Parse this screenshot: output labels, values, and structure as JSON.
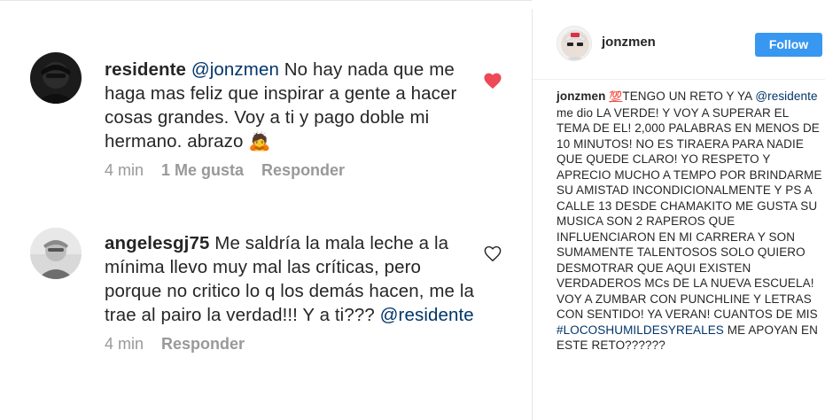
{
  "comments": [
    {
      "username": "residente",
      "mention": "@jonzmen",
      "text": " No hay nada que me haga mas feliz que inspirar a gente a hacer cosas grandes. Voy a ti y pago doble mi hermano. abrazo ",
      "emoji": "🙇",
      "time": "4 min",
      "likes": "1 Me gusta",
      "reply": "Responder",
      "liked": true
    },
    {
      "username": "angelesgj75",
      "text": " Me saldría la mala leche a la mínima llevo muy mal las críticas, pero porque no critico lo q los demás hacen, me la trae al pairo la verdad!!! Y a ti??? ",
      "mention": "@residente",
      "time": "4 min",
      "reply": "Responder",
      "liked": false
    }
  ],
  "post": {
    "username": "jonzmen",
    "follow_label": "Follow",
    "caption": {
      "user": "jonzmen",
      "emoji": "💯",
      "part1": "TENGO UN RETO Y YA ",
      "mention": "@residente",
      "part2": " me dio LA VERDE! Y VOY A SUPERAR EL TEMA DE EL! 2,000 PALABRAS EN MENOS DE 10 MINUTOS! NO ES TIRAERA PARA NADIE QUE QUEDE CLARO! YO RESPETO Y APRECIO MUCHO A TEMPO POR BRINDARME SU AMISTAD INCONDICIONALMENTE Y PS A CALLE 13 DESDE CHAMAKITO ME GUSTA SU MUSICA SON 2 RAPEROS QUE INFLUENCIARON EN MI CARRERA Y SON SUMAMENTE TALENTOSOS SOLO QUIERO DESMOTRAR QUE AQUI EXISTEN VERDADEROS MCs DE LA NUEVA ESCUELA! VOY A ZUMBAR CON PUNCHLINE Y LETRAS CON SENTIDO! YA VERAN! CUANTOS DE MIS ",
      "hashtag": "#LOCOSHUMILDESYREALES",
      "part3": " ME APOYAN EN ESTE RETO??????"
    }
  },
  "colors": {
    "link_blue": "#003569",
    "follow_blue": "#3897f0",
    "heart_red": "#ed4956",
    "meta_grey": "#999999"
  },
  "icons": {
    "liked": "heart-filled-icon",
    "unliked": "heart-outline-icon"
  }
}
